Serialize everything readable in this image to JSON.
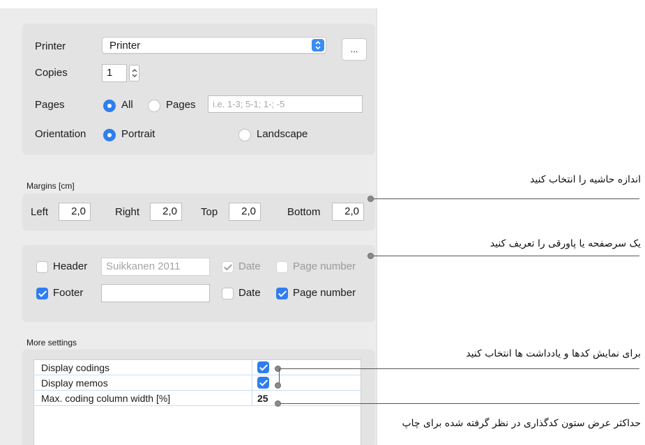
{
  "print_panel": {
    "printer_label": "Printer",
    "printer_value": "Printer",
    "more_button": "...",
    "copies_label": "Copies",
    "copies_value": "1",
    "pages_label": "Pages",
    "pages_all": "All",
    "pages_pages": "Pages",
    "pages_range_placeholder": "i.e. 1-3; 5-1; 1-; -5",
    "pages_selected": "All",
    "orientation_label": "Orientation",
    "orientation_portrait": "Portrait",
    "orientation_landscape": "Landscape",
    "orientation_selected": "Portrait"
  },
  "margins": {
    "title": "Margins [cm]",
    "left_label": "Left",
    "left_value": "2,0",
    "right_label": "Right",
    "right_value": "2,0",
    "top_label": "Top",
    "top_value": "2,0",
    "bottom_label": "Bottom",
    "bottom_value": "2,0"
  },
  "header_footer": {
    "header_label": "Header",
    "header_checked": false,
    "header_text": "Suikkanen 2011",
    "header_date_label": "Date",
    "header_date_checked": true,
    "header_page_number_label": "Page number",
    "header_page_number_checked": false,
    "footer_label": "Footer",
    "footer_checked": true,
    "footer_text": "",
    "footer_date_label": "Date",
    "footer_date_checked": false,
    "footer_page_number_label": "Page number",
    "footer_page_number_checked": true
  },
  "more_settings": {
    "title": "More settings",
    "rows": [
      {
        "name": "Display codings",
        "value": "",
        "checked": true
      },
      {
        "name": "Display memos",
        "value": "",
        "checked": true
      },
      {
        "name": "Max. coding column width [%]",
        "value": "25"
      }
    ]
  },
  "annotations": {
    "margins": "اندازه حاشیه را انتخاب کنید",
    "header_footer": "یک سرصفحه یا پاورقی را تعریف کنید",
    "codings_memos": "برای نمایش کدها و یادداشت ها انتخاب کنید",
    "column_width": "حداکثر عرض ستون کدگذاری در نظر گرفته شده برای چاپ"
  },
  "colors": {
    "accent": "#2f7ef0",
    "panel_bg": "#ececec",
    "group_bg": "#e3e3e3"
  },
  "icons": [
    "up-down-chevron-icon",
    "checkmark-icon",
    "callout-dot-icon"
  ]
}
